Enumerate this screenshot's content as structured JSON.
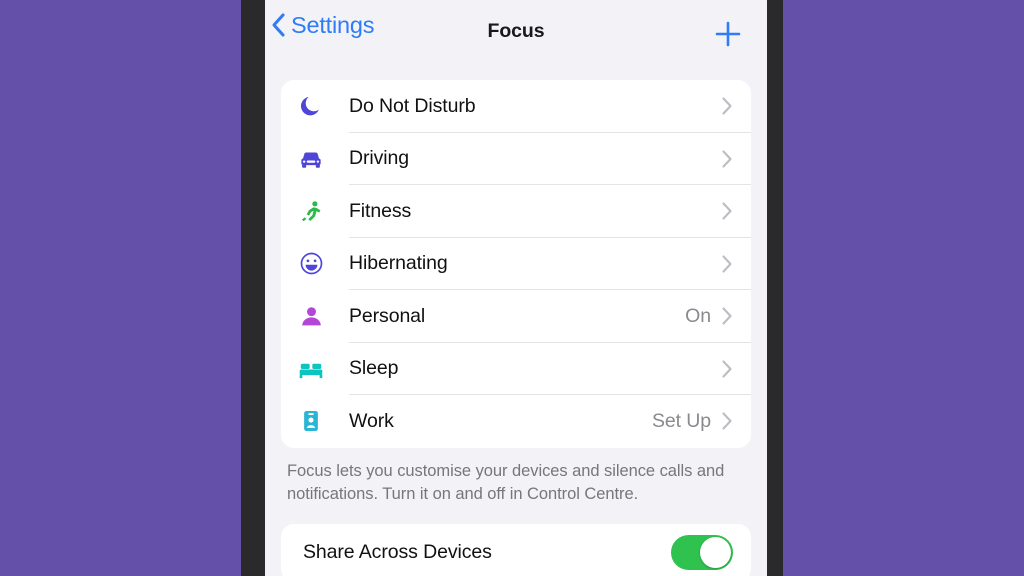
{
  "nav": {
    "back_label": "Settings",
    "title": "Focus",
    "add_icon": "plus-icon",
    "back_icon": "chevron-left-icon"
  },
  "focus_list": [
    {
      "icon": "moon-icon",
      "label": "Do Not Disturb",
      "value": "",
      "color": "#4f46d8"
    },
    {
      "icon": "car-icon",
      "label": "Driving",
      "value": "",
      "color": "#4f46d8"
    },
    {
      "icon": "running-icon",
      "label": "Fitness",
      "value": "",
      "color": "#2cb84c"
    },
    {
      "icon": "smiley-icon",
      "label": "Hibernating",
      "value": "",
      "color": "#4f46d8"
    },
    {
      "icon": "person-icon",
      "label": "Personal",
      "value": "On",
      "color": "#b446d8"
    },
    {
      "icon": "bed-icon",
      "label": "Sleep",
      "value": "",
      "color": "#0fc4be"
    },
    {
      "icon": "badge-icon",
      "label": "Work",
      "value": "Set Up",
      "color": "#2bb5d4"
    }
  ],
  "footer_note": "Focus lets you customise your devices and silence calls and notifications. Turn it on and off in Control Centre.",
  "share": {
    "label": "Share Across Devices",
    "toggle_state": "on"
  },
  "colors": {
    "background": "#6450a8",
    "bezel": "#2a2a2c",
    "screen": "#f2f2f7",
    "card": "#ffffff",
    "accent_blue": "#2f7cf6",
    "toggle_on": "#2fc24f",
    "secondary_text": "#8a8a8e"
  }
}
